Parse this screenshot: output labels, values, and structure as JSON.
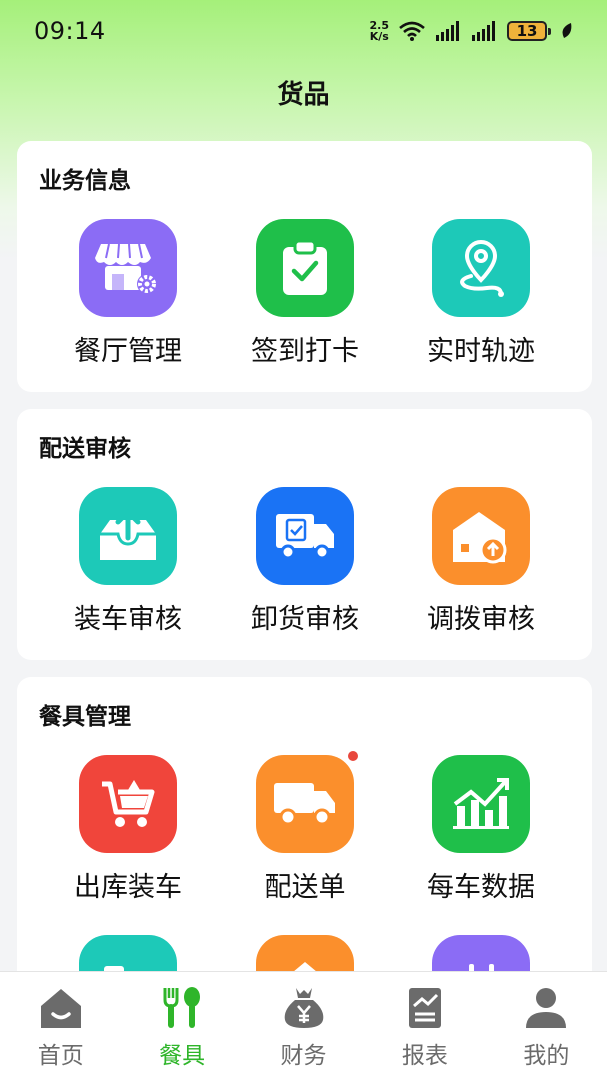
{
  "status": {
    "time": "09:14",
    "net_speed_value": "2.5",
    "net_speed_unit": "K/s",
    "battery": "13"
  },
  "header": {
    "title": "货品"
  },
  "sections": [
    {
      "title": "业务信息",
      "items": [
        {
          "label": "餐厅管理",
          "icon": "store-gear-icon",
          "color": "#8b6cf5"
        },
        {
          "label": "签到打卡",
          "icon": "clipboard-check-icon",
          "color": "#1fbf4a"
        },
        {
          "label": "实时轨迹",
          "icon": "location-route-icon",
          "color": "#1dc9b8"
        }
      ]
    },
    {
      "title": "配送审核",
      "items": [
        {
          "label": "装车审核",
          "icon": "tray-upload-icon",
          "color": "#1dc9b8"
        },
        {
          "label": "卸货审核",
          "icon": "truck-clipboard-icon",
          "color": "#1a73f5"
        },
        {
          "label": "调拨审核",
          "icon": "warehouse-upload-icon",
          "color": "#fb8f2c"
        }
      ]
    },
    {
      "title": "餐具管理",
      "items": [
        {
          "label": "出库装车",
          "icon": "cart-icon",
          "color": "#f0453b"
        },
        {
          "label": "配送单",
          "icon": "truck-icon",
          "color": "#fb8f2c",
          "badge": true
        },
        {
          "label": "每车数据",
          "icon": "growth-chart-icon",
          "color": "#1fbf4a"
        }
      ]
    }
  ],
  "partial_items": [
    {
      "icon": "vehicle-icon",
      "color": "#1dc9b8"
    },
    {
      "icon": "house-icon",
      "color": "#fb8f2c"
    },
    {
      "icon": "calendar-icon",
      "color": "#8b6cf5"
    }
  ],
  "tabbar": {
    "items": [
      {
        "label": "首页",
        "icon": "home-icon"
      },
      {
        "label": "餐具",
        "icon": "fork-spoon-icon",
        "active": true
      },
      {
        "label": "财务",
        "icon": "money-bag-icon"
      },
      {
        "label": "报表",
        "icon": "report-icon"
      },
      {
        "label": "我的",
        "icon": "person-icon"
      }
    ],
    "active_color": "#2fb52a",
    "inactive_color": "#6b6b6b"
  }
}
